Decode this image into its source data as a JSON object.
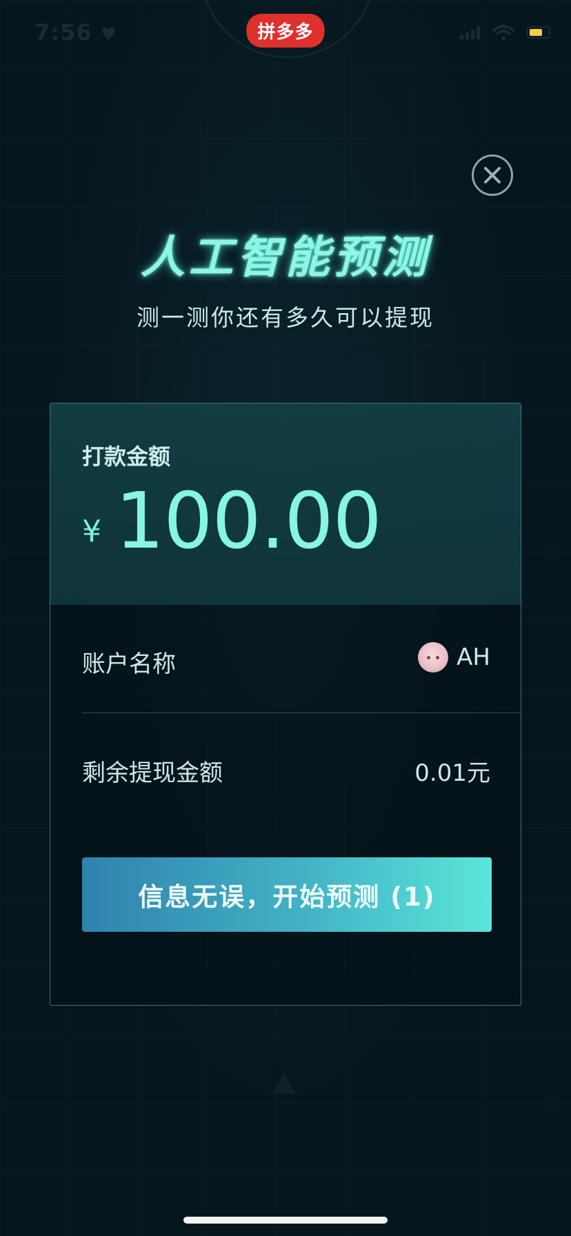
{
  "status_bar": {
    "time": "7:56",
    "app_badge": "拼多多",
    "colors": {
      "battery": "#f2cf46",
      "badge": "#e0302c"
    }
  },
  "icons": {
    "close": "close-icon",
    "heart": "heart-icon",
    "signal": "signal-icon",
    "wifi": "wifi-icon",
    "battery": "battery-icon"
  },
  "header": {
    "title": "人工智能预测",
    "subtitle": "测一测你还有多久可以提现"
  },
  "card": {
    "amount_label": "打款金额",
    "currency_symbol": "¥",
    "amount": "100.00",
    "account_label": "账户名称",
    "account_name": "AH",
    "remaining_label": "剩余提现金额",
    "remaining_value": "0.01元",
    "cta_label": "信息无误，开始预测 (1)"
  },
  "colors": {
    "background": "#06161d",
    "accent": "#86f5e1",
    "button_start": "#2f82ad",
    "button_end": "#5ae6da"
  }
}
